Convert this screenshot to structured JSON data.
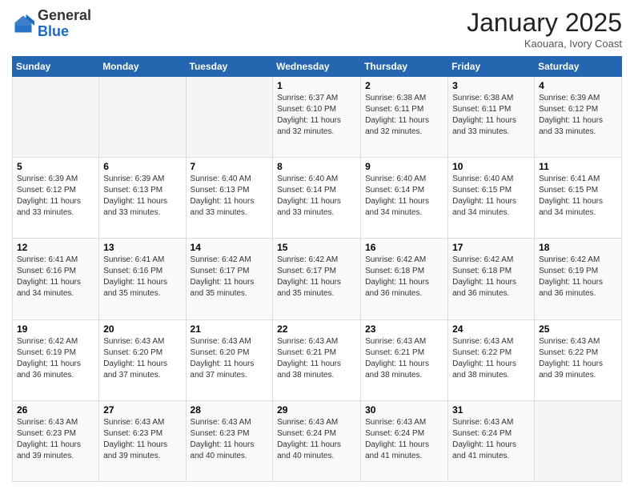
{
  "header": {
    "logo_general": "General",
    "logo_blue": "Blue",
    "month_title": "January 2025",
    "location": "Kaouara, Ivory Coast"
  },
  "weekdays": [
    "Sunday",
    "Monday",
    "Tuesday",
    "Wednesday",
    "Thursday",
    "Friday",
    "Saturday"
  ],
  "weeks": [
    [
      {
        "day": "",
        "info": ""
      },
      {
        "day": "",
        "info": ""
      },
      {
        "day": "",
        "info": ""
      },
      {
        "day": "1",
        "info": "Sunrise: 6:37 AM\nSunset: 6:10 PM\nDaylight: 11 hours\nand 32 minutes."
      },
      {
        "day": "2",
        "info": "Sunrise: 6:38 AM\nSunset: 6:11 PM\nDaylight: 11 hours\nand 32 minutes."
      },
      {
        "day": "3",
        "info": "Sunrise: 6:38 AM\nSunset: 6:11 PM\nDaylight: 11 hours\nand 33 minutes."
      },
      {
        "day": "4",
        "info": "Sunrise: 6:39 AM\nSunset: 6:12 PM\nDaylight: 11 hours\nand 33 minutes."
      }
    ],
    [
      {
        "day": "5",
        "info": "Sunrise: 6:39 AM\nSunset: 6:12 PM\nDaylight: 11 hours\nand 33 minutes."
      },
      {
        "day": "6",
        "info": "Sunrise: 6:39 AM\nSunset: 6:13 PM\nDaylight: 11 hours\nand 33 minutes."
      },
      {
        "day": "7",
        "info": "Sunrise: 6:40 AM\nSunset: 6:13 PM\nDaylight: 11 hours\nand 33 minutes."
      },
      {
        "day": "8",
        "info": "Sunrise: 6:40 AM\nSunset: 6:14 PM\nDaylight: 11 hours\nand 33 minutes."
      },
      {
        "day": "9",
        "info": "Sunrise: 6:40 AM\nSunset: 6:14 PM\nDaylight: 11 hours\nand 34 minutes."
      },
      {
        "day": "10",
        "info": "Sunrise: 6:40 AM\nSunset: 6:15 PM\nDaylight: 11 hours\nand 34 minutes."
      },
      {
        "day": "11",
        "info": "Sunrise: 6:41 AM\nSunset: 6:15 PM\nDaylight: 11 hours\nand 34 minutes."
      }
    ],
    [
      {
        "day": "12",
        "info": "Sunrise: 6:41 AM\nSunset: 6:16 PM\nDaylight: 11 hours\nand 34 minutes."
      },
      {
        "day": "13",
        "info": "Sunrise: 6:41 AM\nSunset: 6:16 PM\nDaylight: 11 hours\nand 35 minutes."
      },
      {
        "day": "14",
        "info": "Sunrise: 6:42 AM\nSunset: 6:17 PM\nDaylight: 11 hours\nand 35 minutes."
      },
      {
        "day": "15",
        "info": "Sunrise: 6:42 AM\nSunset: 6:17 PM\nDaylight: 11 hours\nand 35 minutes."
      },
      {
        "day": "16",
        "info": "Sunrise: 6:42 AM\nSunset: 6:18 PM\nDaylight: 11 hours\nand 36 minutes."
      },
      {
        "day": "17",
        "info": "Sunrise: 6:42 AM\nSunset: 6:18 PM\nDaylight: 11 hours\nand 36 minutes."
      },
      {
        "day": "18",
        "info": "Sunrise: 6:42 AM\nSunset: 6:19 PM\nDaylight: 11 hours\nand 36 minutes."
      }
    ],
    [
      {
        "day": "19",
        "info": "Sunrise: 6:42 AM\nSunset: 6:19 PM\nDaylight: 11 hours\nand 36 minutes."
      },
      {
        "day": "20",
        "info": "Sunrise: 6:43 AM\nSunset: 6:20 PM\nDaylight: 11 hours\nand 37 minutes."
      },
      {
        "day": "21",
        "info": "Sunrise: 6:43 AM\nSunset: 6:20 PM\nDaylight: 11 hours\nand 37 minutes."
      },
      {
        "day": "22",
        "info": "Sunrise: 6:43 AM\nSunset: 6:21 PM\nDaylight: 11 hours\nand 38 minutes."
      },
      {
        "day": "23",
        "info": "Sunrise: 6:43 AM\nSunset: 6:21 PM\nDaylight: 11 hours\nand 38 minutes."
      },
      {
        "day": "24",
        "info": "Sunrise: 6:43 AM\nSunset: 6:22 PM\nDaylight: 11 hours\nand 38 minutes."
      },
      {
        "day": "25",
        "info": "Sunrise: 6:43 AM\nSunset: 6:22 PM\nDaylight: 11 hours\nand 39 minutes."
      }
    ],
    [
      {
        "day": "26",
        "info": "Sunrise: 6:43 AM\nSunset: 6:23 PM\nDaylight: 11 hours\nand 39 minutes."
      },
      {
        "day": "27",
        "info": "Sunrise: 6:43 AM\nSunset: 6:23 PM\nDaylight: 11 hours\nand 39 minutes."
      },
      {
        "day": "28",
        "info": "Sunrise: 6:43 AM\nSunset: 6:23 PM\nDaylight: 11 hours\nand 40 minutes."
      },
      {
        "day": "29",
        "info": "Sunrise: 6:43 AM\nSunset: 6:24 PM\nDaylight: 11 hours\nand 40 minutes."
      },
      {
        "day": "30",
        "info": "Sunrise: 6:43 AM\nSunset: 6:24 PM\nDaylight: 11 hours\nand 41 minutes."
      },
      {
        "day": "31",
        "info": "Sunrise: 6:43 AM\nSunset: 6:24 PM\nDaylight: 11 hours\nand 41 minutes."
      },
      {
        "day": "",
        "info": ""
      }
    ]
  ]
}
